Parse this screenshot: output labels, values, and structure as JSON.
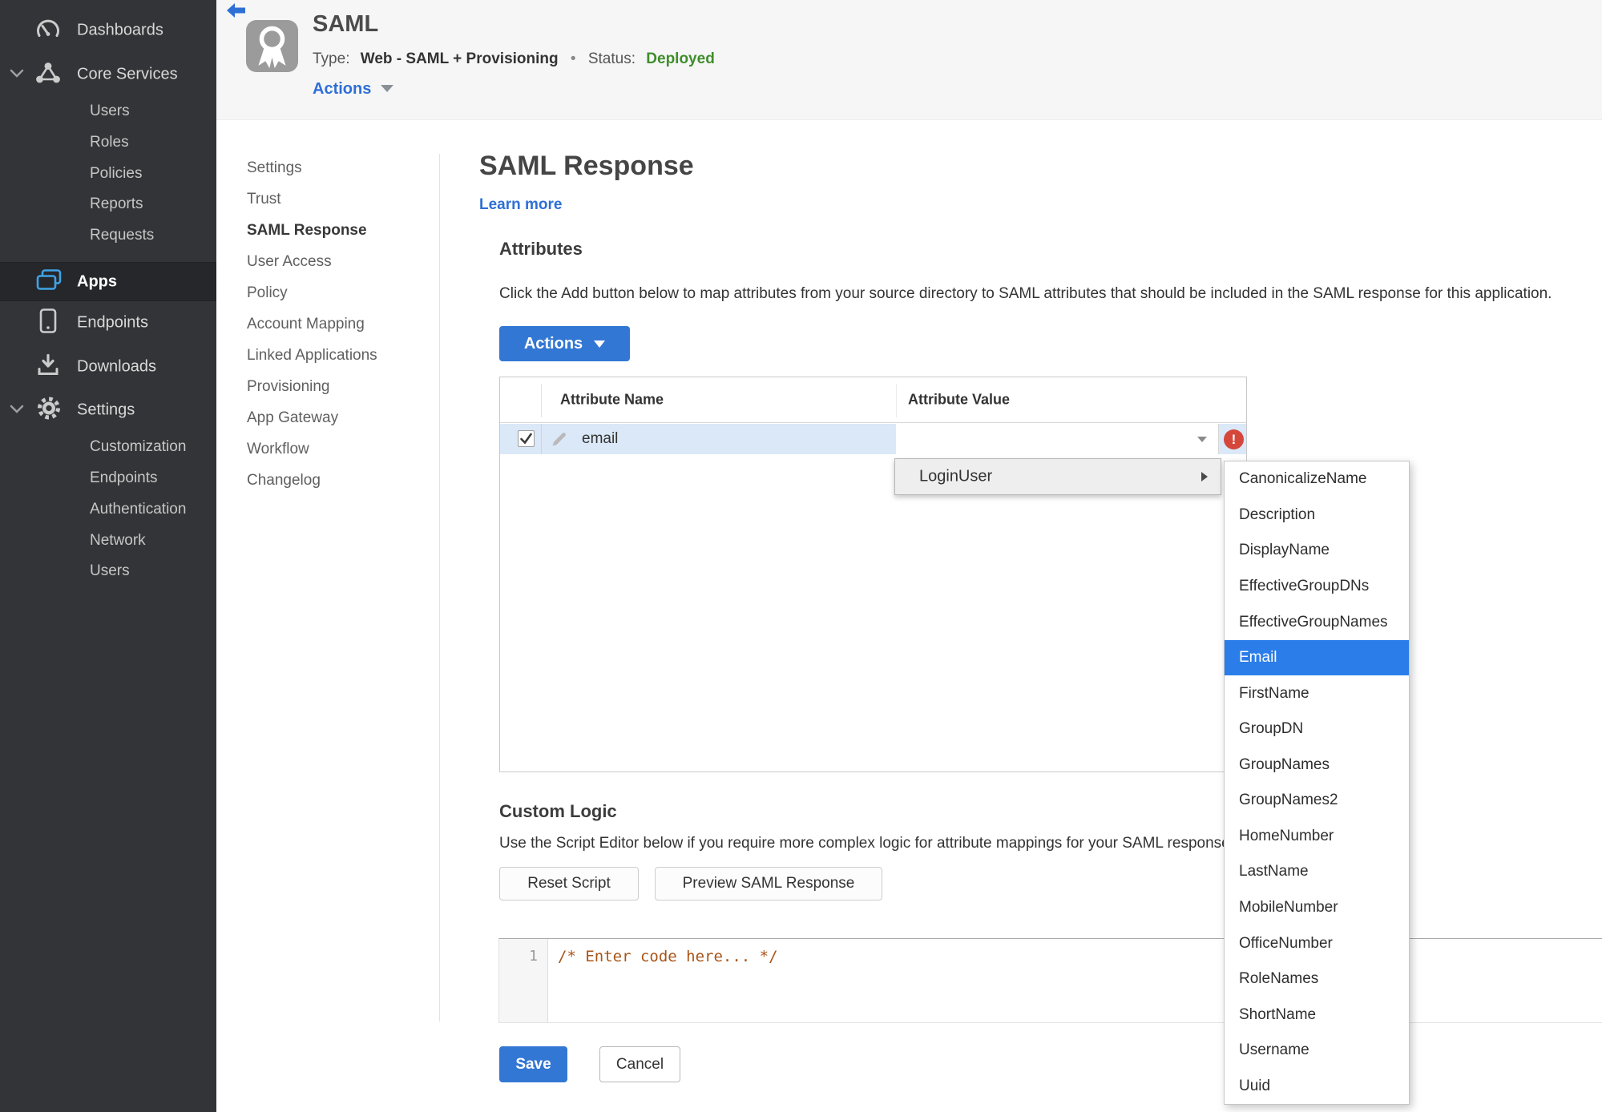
{
  "colors": {
    "accent_blue": "#3377d4",
    "selection_blue": "#2b7de9",
    "status_green": "#3e8e2a",
    "error_red": "#d5473b",
    "row_highlight": "#dbe8f8",
    "sidebar_bg": "#333437"
  },
  "sidebar": {
    "dashboards": "Dashboards",
    "core_services": "Core Services",
    "core_items": [
      "Users",
      "Roles",
      "Policies",
      "Reports",
      "Requests"
    ],
    "apps": "Apps",
    "endpoints": "Endpoints",
    "downloads": "Downloads",
    "settings": "Settings",
    "settings_items": [
      "Customization",
      "Endpoints",
      "Authentication",
      "Network",
      "Users"
    ]
  },
  "header": {
    "title": "SAML",
    "type_label": "Type:",
    "type_value": "Web - SAML + Provisioning",
    "dot": "•",
    "status_label": "Status:",
    "status_value": "Deployed",
    "actions": "Actions"
  },
  "subnav": {
    "items": [
      "Settings",
      "Trust",
      "SAML Response",
      "User Access",
      "Policy",
      "Account Mapping",
      "Linked Applications",
      "Provisioning",
      "App Gateway",
      "Workflow",
      "Changelog"
    ],
    "active": "SAML Response"
  },
  "main": {
    "title": "SAML Response",
    "learn_more": "Learn more",
    "attributes": {
      "heading": "Attributes",
      "description": "Click the Add button below to map attributes from your source directory to SAML attributes that should be included in the SAML response for this application.",
      "actions_button": "Actions",
      "columns": [
        "Attribute Name",
        "Attribute Value"
      ],
      "row": {
        "name": "email",
        "value": ""
      }
    },
    "custom_logic": {
      "heading": "Custom Logic",
      "description": "Use the Script Editor below if you require more complex logic for attribute mappings for your SAML response.",
      "reset_button": "Reset Script",
      "preview_button": "Preview SAML Response",
      "line_number": "1",
      "code": "/* Enter code here... */"
    },
    "save_button": "Save",
    "cancel_button": "Cancel"
  },
  "value_menu": {
    "label": "LoginUser"
  },
  "value_submenu": {
    "selected": "Email",
    "items": [
      "CanonicalizeName",
      "Description",
      "DisplayName",
      "EffectiveGroupDNs",
      "EffectiveGroupNames",
      "Email",
      "FirstName",
      "GroupDN",
      "GroupNames",
      "GroupNames2",
      "HomeNumber",
      "LastName",
      "MobileNumber",
      "OfficeNumber",
      "RoleNames",
      "ShortName",
      "Username",
      "Uuid"
    ]
  }
}
